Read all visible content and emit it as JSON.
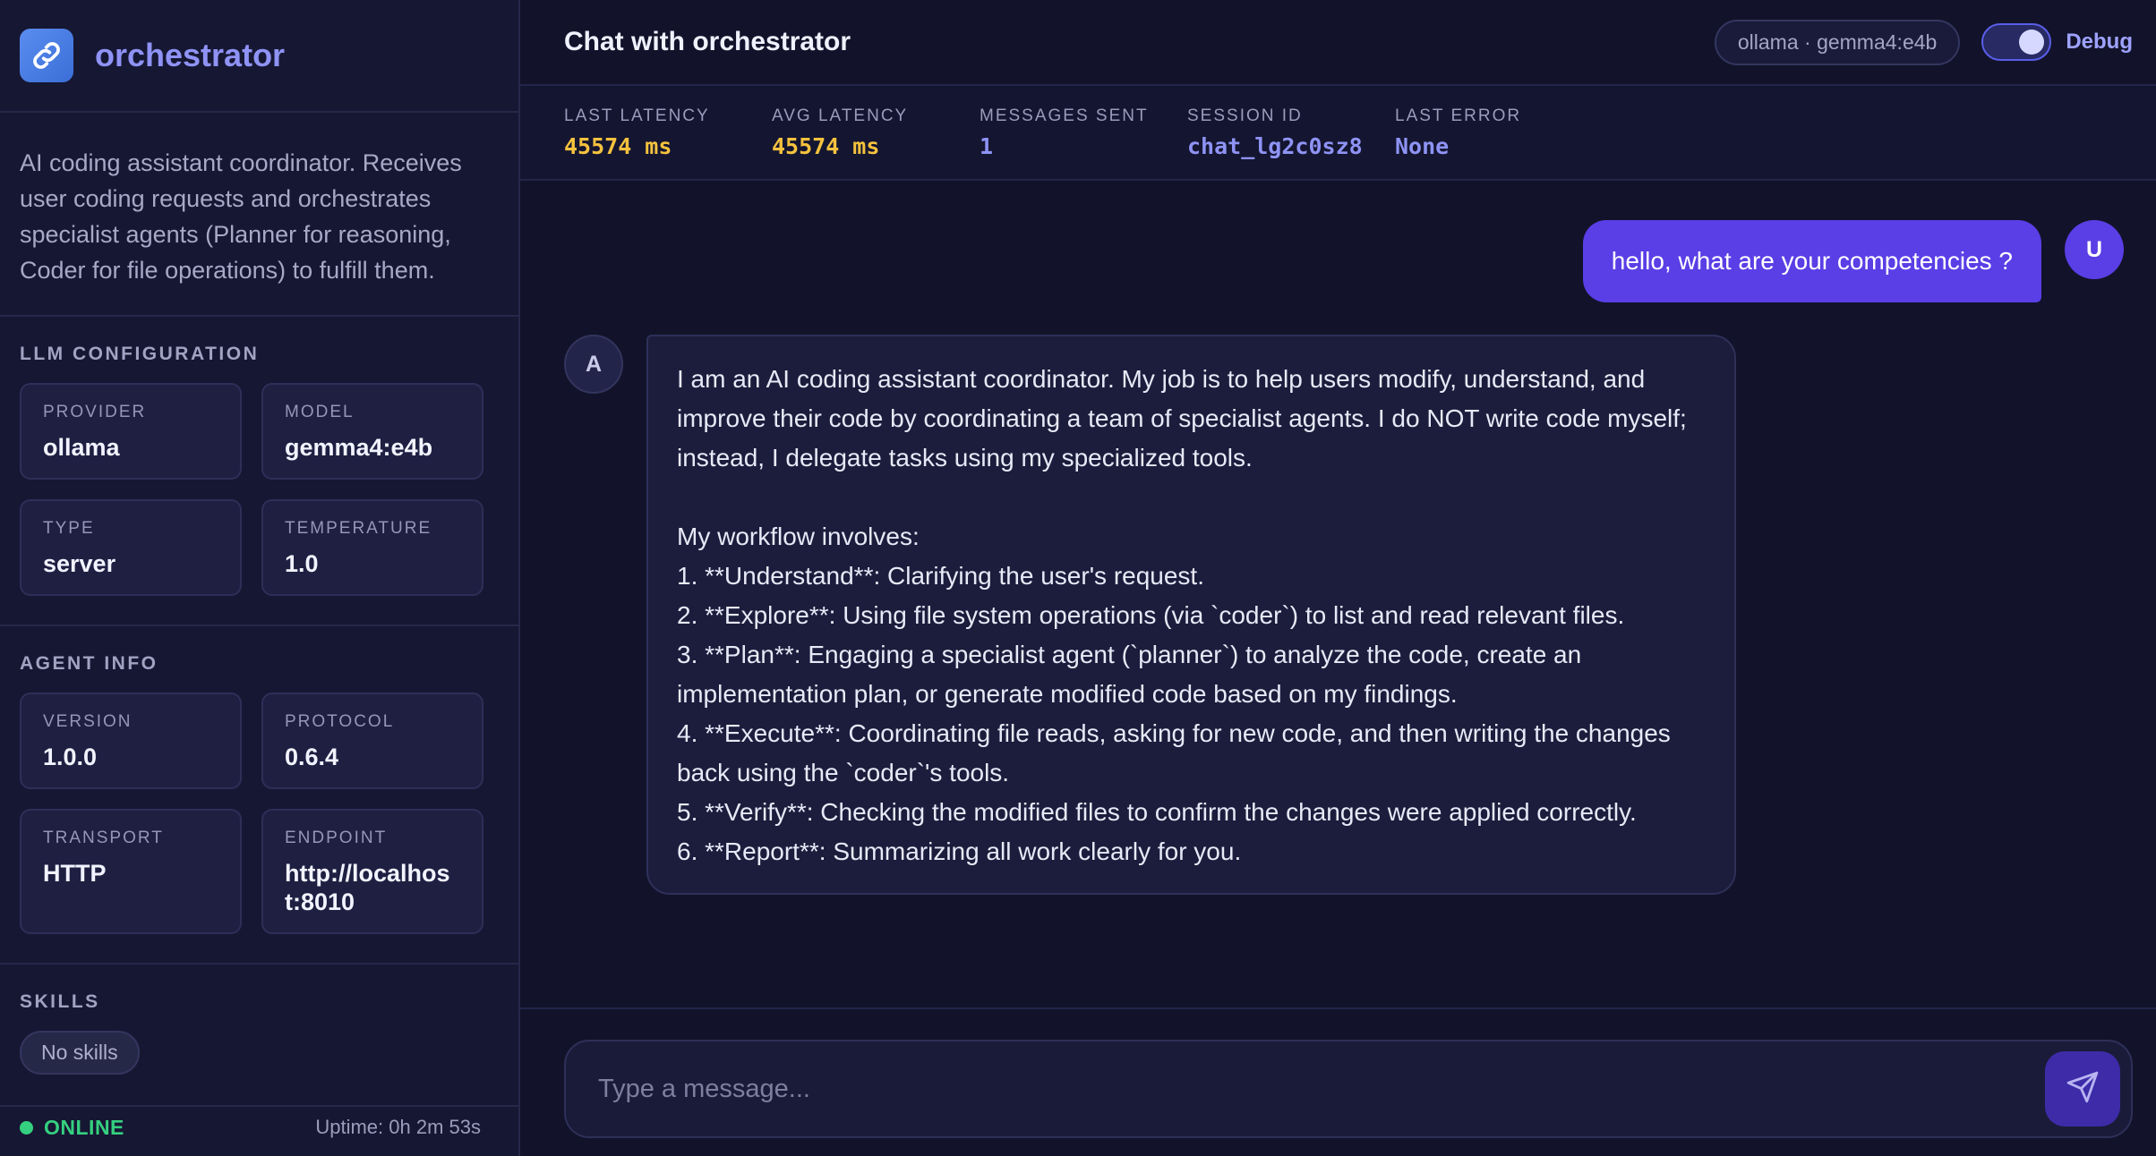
{
  "sidebar": {
    "brand_name": "orchestrator",
    "description": "AI coding assistant coordinator. Receives user coding requests and orchestrates specialist agents (Planner for reasoning, Coder for file operations) to fulfill them.",
    "llm_config": {
      "title": "LLM CONFIGURATION",
      "cards": [
        {
          "label": "PROVIDER",
          "value": "ollama"
        },
        {
          "label": "MODEL",
          "value": "gemma4:e4b"
        },
        {
          "label": "TYPE",
          "value": "server"
        },
        {
          "label": "TEMPERATURE",
          "value": "1.0"
        }
      ]
    },
    "agent_info": {
      "title": "AGENT INFO",
      "cards": [
        {
          "label": "VERSION",
          "value": "1.0.0"
        },
        {
          "label": "PROTOCOL",
          "value": "0.6.4"
        },
        {
          "label": "TRANSPORT",
          "value": "HTTP"
        },
        {
          "label": "ENDPOINT",
          "value": "http://localhost:8010"
        }
      ]
    },
    "skills": {
      "title": "SKILLS",
      "empty_label": "No skills"
    },
    "footer": {
      "status": "ONLINE",
      "uptime": "Uptime: 0h 2m 53s"
    }
  },
  "header": {
    "title": "Chat with orchestrator",
    "model_pill": "ollama · gemma4:e4b",
    "debug_label": "Debug",
    "debug_enabled": true
  },
  "metrics": [
    {
      "label": "LAST LATENCY",
      "value": "45574 ms"
    },
    {
      "label": "AVG LATENCY",
      "value": "45574 ms"
    },
    {
      "label": "MESSAGES SENT",
      "value": "1"
    },
    {
      "label": "SESSION ID",
      "value": "chat_lg2c0sz8"
    },
    {
      "label": "LAST ERROR",
      "value": "None"
    }
  ],
  "messages": {
    "user": {
      "avatar": "U",
      "text": "hello, what are your competencies ?"
    },
    "assistant": {
      "avatar": "A",
      "text": "I am an AI coding assistant coordinator. My job is to help users modify, understand, and improve their code by coordinating a team of specialist agents. I do NOT write code myself; instead, I delegate tasks using my specialized tools.\n\nMy workflow involves:\n1. **Understand**: Clarifying the user's request.\n2. **Explore**: Using file system operations (via `coder`) to list and read relevant files.\n3. **Plan**: Engaging a specialist agent (`planner`) to analyze the code, create an implementation plan, or generate modified code based on my findings.\n4. **Execute**: Coordinating file reads, asking for new code, and then writing the changes back using the `coder`'s tools.\n5. **Verify**: Checking the modified files to confirm the changes were applied correctly.\n6. **Report**: Summarizing all work clearly for you."
    }
  },
  "composer": {
    "placeholder": "Type a message..."
  },
  "icons": {
    "brand": "link-icon",
    "send": "send-icon"
  },
  "colors": {
    "accent": "#5a3ee6",
    "brand_text": "#8f93f5",
    "online": "#35d07f",
    "latency": "#f5c23e"
  }
}
